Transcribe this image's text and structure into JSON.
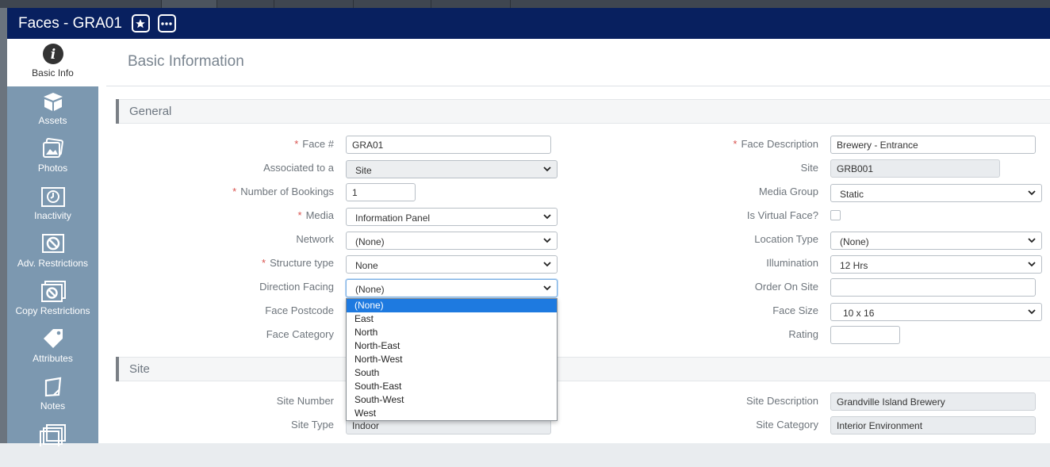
{
  "window": {
    "title": "Faces - GRA01",
    "favorite_icon": "star-icon",
    "more_icon": "ellipsis-icon"
  },
  "sidebar": {
    "items": [
      {
        "label": "Basic Info",
        "icon": "info-icon",
        "active": true
      },
      {
        "label": "Assets",
        "icon": "box-icon"
      },
      {
        "label": "Photos",
        "icon": "photos-icon"
      },
      {
        "label": "Inactivity",
        "icon": "clock-calendar-icon"
      },
      {
        "label": "Adv. Restrictions",
        "icon": "restriction-icon"
      },
      {
        "label": "Copy Restrictions",
        "icon": "copy-restriction-icon"
      },
      {
        "label": "Attributes",
        "icon": "tags-icon"
      },
      {
        "label": "Notes",
        "icon": "note-icon"
      },
      {
        "label": "",
        "icon": "copies-icon"
      }
    ]
  },
  "page": {
    "title": "Basic Information"
  },
  "sections": {
    "general": "General",
    "site": "Site"
  },
  "general": {
    "face_no": {
      "label": "Face #",
      "value": "GRA01"
    },
    "associated_to": {
      "label": "Associated to a",
      "value": "Site"
    },
    "num_bookings": {
      "label": "Number of Bookings",
      "value": "1"
    },
    "media": {
      "label": "Media",
      "value": "Information Panel"
    },
    "network": {
      "label": "Network",
      "value": "(None)"
    },
    "structure_type": {
      "label": "Structure type",
      "value": "None"
    },
    "direction_facing": {
      "label": "Direction Facing",
      "value": "(None)"
    },
    "face_postcode": {
      "label": "Face Postcode"
    },
    "face_category": {
      "label": "Face Category"
    },
    "face_description": {
      "label": "Face Description",
      "value": "Brewery - Entrance"
    },
    "site": {
      "label": "Site",
      "value": "GRB001"
    },
    "media_group": {
      "label": "Media Group",
      "value": "Static"
    },
    "is_virtual": {
      "label": "Is Virtual Face?",
      "checked": false
    },
    "location_type": {
      "label": "Location Type",
      "value": "(None)"
    },
    "illumination": {
      "label": "Illumination",
      "value": "12 Hrs"
    },
    "order_on_site": {
      "label": "Order On Site",
      "value": ""
    },
    "face_size": {
      "label": "Face Size",
      "value": "10 x 16"
    },
    "rating": {
      "label": "Rating",
      "value": ""
    }
  },
  "site": {
    "site_number": {
      "label": "Site Number"
    },
    "site_type": {
      "label": "Site Type",
      "value": "Indoor"
    },
    "site_description": {
      "label": "Site Description",
      "value": "Grandville Island Brewery"
    },
    "site_category": {
      "label": "Site Category",
      "value": "Interior Environment"
    }
  },
  "direction_dropdown": {
    "options": [
      "(None)",
      "East",
      "North",
      "North-East",
      "North-West",
      "South",
      "South-East",
      "South-West",
      "West"
    ],
    "selected": "(None)"
  },
  "colors": {
    "titlebar": "#08205f",
    "sidebar": "#7c98b0",
    "selected_option": "#1e7ae0",
    "required": "#d9534f"
  }
}
